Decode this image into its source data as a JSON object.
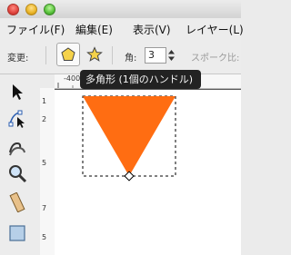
{
  "menubar": {
    "items": [
      "ファイル(F)",
      "編集(E)",
      "表示(V)",
      "レイヤー(L)"
    ]
  },
  "toolbar": {
    "mode_label": "変更:",
    "polygon_tool": "polygon-mode",
    "star_tool": "star-mode",
    "corners_label": "角:",
    "corners_value": "3",
    "spoke_label": "スポーク比:"
  },
  "tooltip": {
    "text": "多角形 (1個のハンドル)"
  },
  "ruler": {
    "h_label": "-400",
    "v_labels": [
      "1",
      "2",
      "5",
      "7",
      "5"
    ]
  },
  "tools": [
    "selector-tool",
    "node-tool",
    "tweak-tool",
    "zoom-tool",
    "measure-tool",
    "rect-tool"
  ],
  "shape": {
    "fill": "#ff6d12",
    "kind": "triangle"
  },
  "colors": {
    "accent": "#ff6d12",
    "tooltip_bg": "#222222"
  }
}
